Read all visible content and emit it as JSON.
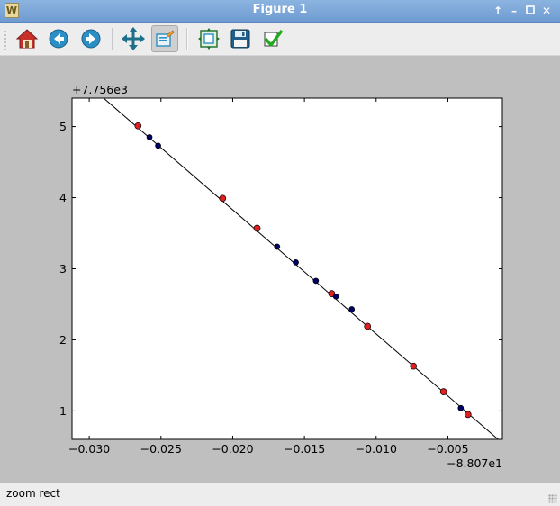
{
  "window": {
    "title": "Figure 1",
    "controls": [
      "pin",
      "minimize",
      "maximize",
      "close"
    ]
  },
  "toolbar": {
    "buttons": [
      {
        "name": "home",
        "icon": "home-icon",
        "active": false
      },
      {
        "name": "back",
        "icon": "arrow-left-icon",
        "active": false
      },
      {
        "name": "forward",
        "icon": "arrow-right-icon",
        "active": false
      },
      {
        "name": "pan",
        "icon": "move-icon",
        "active": false
      },
      {
        "name": "zoom",
        "icon": "zoom-rect-icon",
        "active": true
      },
      {
        "name": "subplots",
        "icon": "subplots-icon",
        "active": false
      },
      {
        "name": "save",
        "icon": "floppy-disk-icon",
        "active": false
      },
      {
        "name": "edit-parameters",
        "icon": "checkmark-icon",
        "active": false
      }
    ]
  },
  "status": {
    "text": "zoom rect"
  },
  "colors": {
    "titlebar": "#7ea8d9",
    "red_points": "#e02020",
    "navy_points": "#000066",
    "line": "#000000"
  },
  "chart_data": {
    "type": "scatter",
    "title": "",
    "xlabel": "",
    "ylabel": "",
    "x_offset_text": "−8.807e1",
    "y_offset_text": "+7.756e3",
    "xlim": [
      -0.0312,
      -0.0012
    ],
    "ylim": [
      0.6,
      5.4
    ],
    "xticks": [
      -0.03,
      -0.025,
      -0.02,
      -0.015,
      -0.01,
      -0.005
    ],
    "xtick_labels": [
      "−0.030",
      "−0.025",
      "−0.020",
      "−0.015",
      "−0.010",
      "−0.005"
    ],
    "yticks": [
      1,
      2,
      3,
      4,
      5
    ],
    "ytick_labels": [
      "1",
      "2",
      "3",
      "4",
      "5"
    ],
    "grid": false,
    "series": [
      {
        "kind": "line",
        "color": "#000000",
        "x": [
          -0.029,
          -0.0015
        ],
        "y": [
          5.4,
          0.6
        ]
      },
      {
        "kind": "points",
        "color": "#e02020",
        "x": [
          -0.0266,
          -0.0207,
          -0.0183,
          -0.0131,
          -0.0106,
          -0.0074,
          -0.0053,
          -0.0036
        ],
        "y": [
          5.01,
          3.99,
          3.57,
          2.65,
          2.19,
          1.63,
          1.27,
          0.95
        ]
      },
      {
        "kind": "points",
        "color": "#000066",
        "x": [
          -0.0258,
          -0.0252,
          -0.0169,
          -0.0156,
          -0.0142,
          -0.0128,
          -0.0117,
          -0.0041
        ],
        "y": [
          4.85,
          4.73,
          3.31,
          3.09,
          2.83,
          2.61,
          2.43,
          1.04
        ]
      }
    ]
  }
}
